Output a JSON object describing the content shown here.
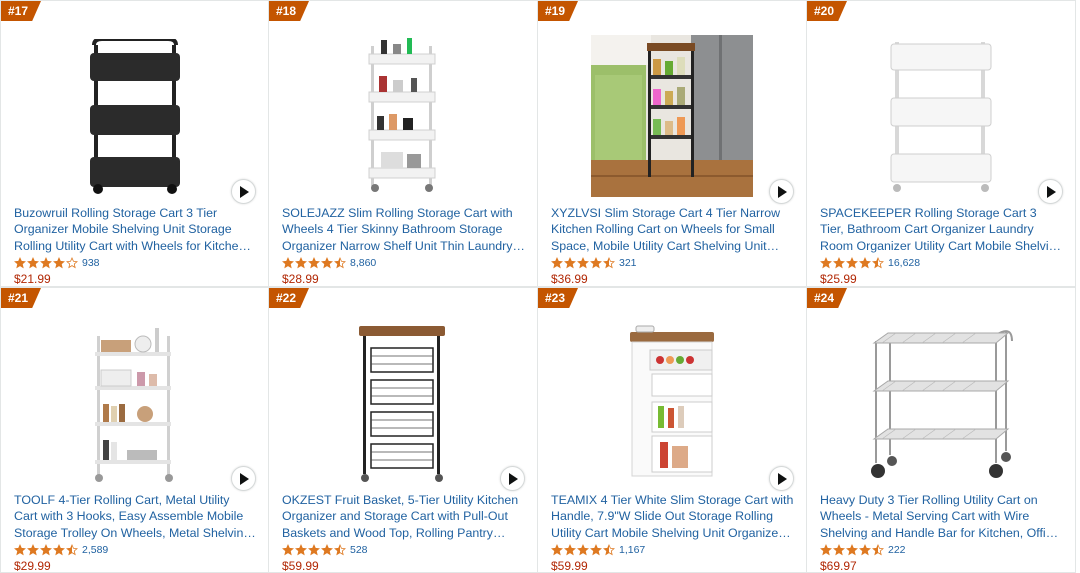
{
  "colors": {
    "rank_badge": "#c45500",
    "link": "#2162a1",
    "price": "#b12704",
    "star": "#de7921"
  },
  "products": [
    {
      "rank": "#17",
      "title": "Buzowruil Rolling Storage Cart 3 Tier Organizer Mobile Shelving Unit Storage Rolling Utility Cart with Wheels for Kitchen Bathroom Laundry…",
      "rating": 4.0,
      "reviews": "938",
      "price": "$21.99",
      "image": "black-3-tier-cart"
    },
    {
      "rank": "#18",
      "title": "SOLEJAZZ Slim Rolling Storage Cart with Wheels 4 Tier Skinny Bathroom Storage Organizer Narrow Shelf Unit Thin Laundry Room…",
      "rating": 4.5,
      "reviews": "8,860",
      "price": "$28.99",
      "image": "white-slim-4-tier-cart"
    },
    {
      "rank": "#19",
      "title": "XYZLVSI Slim Storage Cart 4 Tier Narrow Kitchen Rolling Cart on Wheels for Small Space, Mobile Utility Cart Shelving Unit with…",
      "rating": 4.5,
      "reviews": "321",
      "price": "$36.99",
      "image": "kitchen-slim-cart-photo"
    },
    {
      "rank": "#20",
      "title": "SPACEKEEPER Rolling Storage Cart 3 Tier, Bathroom Cart Organizer Laundry Room Organizer Utility Cart Mobile Shelving Unit…",
      "rating": 4.5,
      "reviews": "16,628",
      "price": "$25.99",
      "image": "white-3-tier-cart"
    },
    {
      "rank": "#21",
      "title": "TOOLF 4-Tier Rolling Cart, Metal Utility Cart with 3 Hooks, Easy Assemble Mobile Storage Trolley On Wheels, Metal Shelving Units…",
      "rating": 4.5,
      "reviews": "2,589",
      "price": "$29.99",
      "image": "white-metal-4-tier-cart"
    },
    {
      "rank": "#22",
      "title": "OKZEST Fruit Basket, 5-Tier Utility Kitchen Organizer and Storage Cart with Pull-Out Baskets and Wood Top, Rolling Pantry Kitchen…",
      "rating": 4.5,
      "reviews": "528",
      "price": "$59.99",
      "image": "black-basket-cart"
    },
    {
      "rank": "#23",
      "title": "TEAMIX 4 Tier White Slim Storage Cart with Handle, 7.9\"W Slide Out Storage Rolling Utility Cart Mobile Shelving Unit Organizer Trolley for…",
      "rating": 4.5,
      "reviews": "1,167",
      "price": "$59.99",
      "image": "white-slide-out-cart"
    },
    {
      "rank": "#24",
      "title": "Heavy Duty 3 Tier Rolling Utility Cart on Wheels - Metal Serving Cart with Wire Shelving and Handle Bar for Kitchen, Office, Hardware",
      "rating": 4.5,
      "reviews": "222",
      "price": "$69.97",
      "image": "chrome-wire-cart"
    }
  ]
}
